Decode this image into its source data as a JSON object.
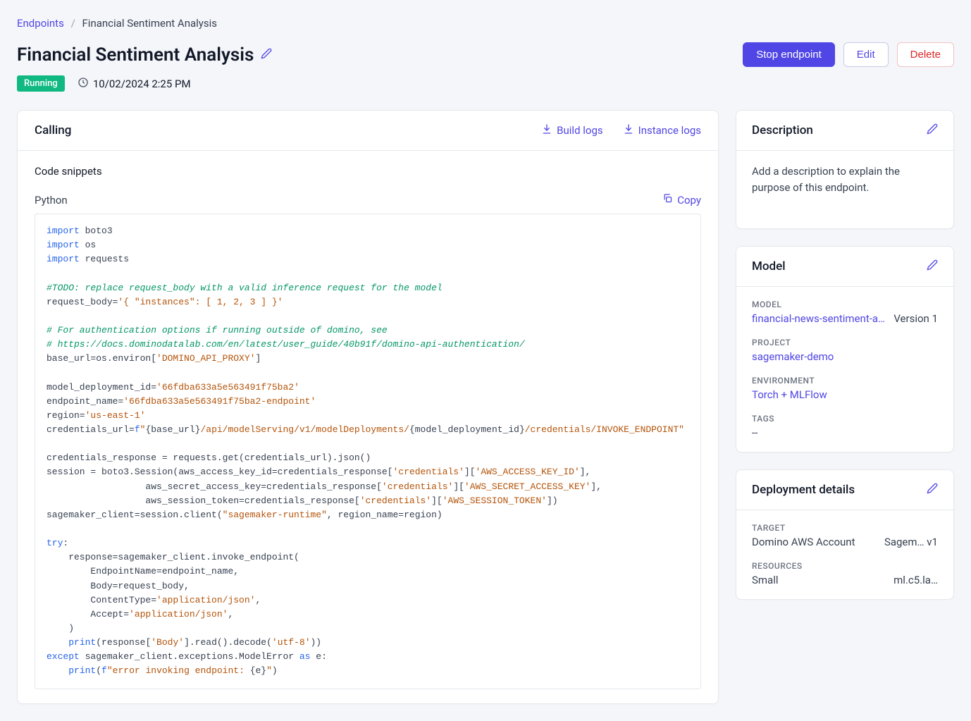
{
  "breadcrumb": {
    "root": "Endpoints",
    "current": "Financial Sentiment Analysis"
  },
  "header": {
    "title": "Financial Sentiment Analysis",
    "stop_label": "Stop endpoint",
    "edit_label": "Edit",
    "delete_label": "Delete"
  },
  "status": {
    "badge": "Running",
    "timestamp": "10/02/2024 2:25 PM"
  },
  "calling": {
    "title": "Calling",
    "build_logs": "Build logs",
    "instance_logs": "Instance logs",
    "snippets_label": "Code snippets",
    "language": "Python",
    "copy": "Copy"
  },
  "description": {
    "title": "Description",
    "placeholder": "Add a description to explain the purpose of this endpoint."
  },
  "model": {
    "title": "Model",
    "labels": {
      "model": "MODEL",
      "project": "PROJECT",
      "environment": "ENVIRONMENT",
      "tags": "TAGS"
    },
    "values": {
      "model_name": "financial-news-sentiment-an…",
      "version_label": "Version",
      "version": "1",
      "project": "sagemaker-demo",
      "environment": "Torch + MLFlow",
      "tags": "--"
    }
  },
  "deployment": {
    "title": "Deployment details",
    "labels": {
      "target": "TARGET",
      "resources": "RESOURCES"
    },
    "values": {
      "target_left": "Domino AWS Account",
      "target_right": "Sagem… v1",
      "resources_left": "Small",
      "resources_right": "ml.c5.la…"
    }
  },
  "code": {
    "deployment_id": "66fdba633a5e563491f75ba2",
    "endpoint_name": "66fdba633a5e563491f75ba2-endpoint",
    "region": "us-east-1"
  }
}
